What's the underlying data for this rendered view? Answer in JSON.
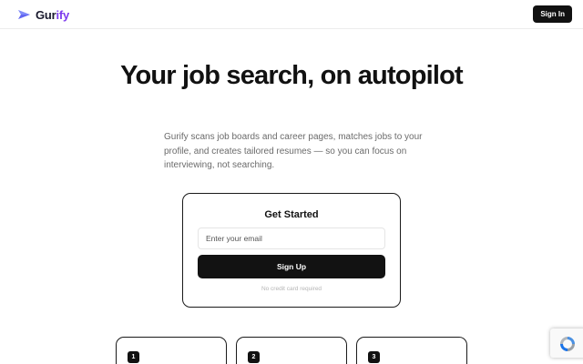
{
  "header": {
    "logo_part1": "Gur",
    "logo_part2": "ify",
    "signin_label": "Sign In"
  },
  "hero": {
    "title": "Your job search, on autopilot",
    "subtitle": "Gurify scans job boards and career pages, matches jobs to your profile, and creates tailored resumes — so you can focus on interviewing, not searching."
  },
  "signup_card": {
    "title": "Get Started",
    "email_placeholder": "Enter your email",
    "button_label": "Sign Up",
    "note": "No credit card required"
  },
  "steps": [
    {
      "number": "1"
    },
    {
      "number": "2"
    },
    {
      "number": "3"
    }
  ],
  "colors": {
    "brand_dark": "#1a1a2e",
    "brand_accent": "#7c3aed",
    "button_bg": "#111111"
  },
  "icons": {
    "logo": "paper-plane-logo-icon",
    "recaptcha": "recaptcha-icon"
  }
}
